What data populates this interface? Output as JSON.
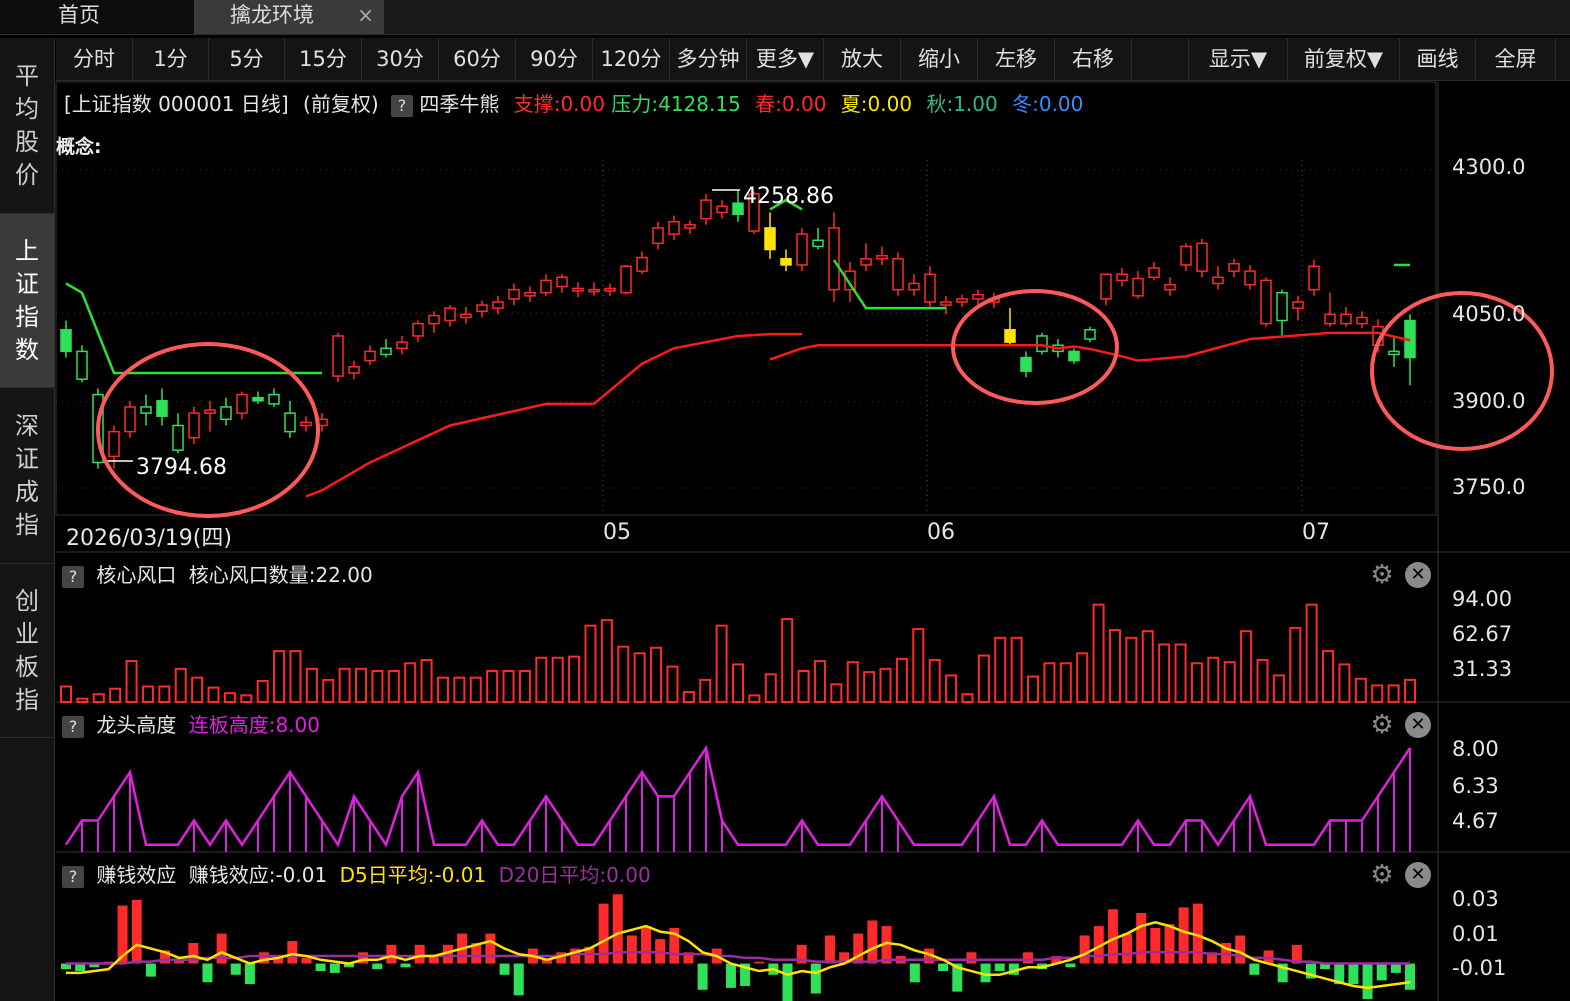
{
  "tabs": {
    "home": "首页",
    "active": "擒龙环境",
    "close": "×"
  },
  "sidebar": [
    {
      "label": "平均股价",
      "active": false
    },
    {
      "label": "上证指数",
      "active": true
    },
    {
      "label": "深证成指",
      "active": false
    },
    {
      "label": "创业板指",
      "active": false
    }
  ],
  "toolbar": [
    "分时",
    "1分",
    "5分",
    "15分",
    "30分",
    "60分",
    "90分",
    "120分",
    "多分钟",
    "更多▼",
    "放大",
    "缩小",
    "左移",
    "右移",
    "",
    "显示▼",
    "前复权▼",
    "画线",
    "全屏"
  ],
  "info": {
    "title": "[上证指数 000001 日线]",
    "adjust": "(前复权)",
    "indicator": "四季牛熊",
    "support": "支撑:0.00",
    "pressure": "压力:4128.15",
    "spring": "春:0.00",
    "summer": "夏:0.00",
    "autumn": "秋:1.00",
    "winter": "冬:0.00"
  },
  "concept_label": "概念:",
  "colors": {
    "up": "#ff2a2a",
    "down": "#2ee05a",
    "yellow": "#ffe400",
    "magenta": "#e020e0",
    "purple": "#9b2fa0",
    "green_line": "#2ee02e",
    "support_line": "#ff1a1a",
    "circle": "#ff5a5a"
  },
  "chart_data": [
    {
      "type": "candlestick",
      "title": "上证指数 000001 日线",
      "y_ticks": [
        "4300.0",
        "4050.0",
        "3900.0",
        "3750.0"
      ],
      "ylim": [
        3735,
        4310
      ],
      "x_labels": [
        "2026/03/19(四)",
        "05",
        "06",
        "07"
      ],
      "annotations": {
        "high": "4258.86",
        "low": "3794.68"
      },
      "ohlc": [
        [
          4035,
          4050,
          3990,
          4000,
          0
        ],
        [
          4000,
          4010,
          3950,
          3955,
          0
        ],
        [
          3930,
          3940,
          3810,
          3820,
          0
        ],
        [
          3830,
          3880,
          3810,
          3870,
          1
        ],
        [
          3870,
          3920,
          3860,
          3910,
          1
        ],
        [
          3910,
          3930,
          3880,
          3900,
          0
        ],
        [
          3920,
          3940,
          3880,
          3895,
          0
        ],
        [
          3880,
          3900,
          3835,
          3840,
          0
        ],
        [
          3860,
          3910,
          3850,
          3900,
          1
        ],
        [
          3900,
          3920,
          3870,
          3905,
          1
        ],
        [
          3910,
          3925,
          3880,
          3890,
          0
        ],
        [
          3900,
          3935,
          3890,
          3930,
          1
        ],
        [
          3925,
          3935,
          3915,
          3920,
          0
        ],
        [
          3930,
          3940,
          3910,
          3915,
          0
        ],
        [
          3900,
          3920,
          3860,
          3870,
          0
        ],
        [
          3885,
          3895,
          3870,
          3880,
          1
        ],
        [
          3880,
          3900,
          3870,
          3890,
          1
        ],
        [
          3960,
          4030,
          3950,
          4025,
          1
        ],
        [
          3965,
          3985,
          3955,
          3975,
          1
        ],
        [
          3985,
          4010,
          3978,
          4000,
          1
        ],
        [
          3995,
          4020,
          3990,
          4005,
          0
        ],
        [
          4005,
          4025,
          3995,
          4015,
          1
        ],
        [
          4025,
          4050,
          4015,
          4045,
          1
        ],
        [
          4045,
          4065,
          4030,
          4058,
          1
        ],
        [
          4050,
          4075,
          4040,
          4070,
          1
        ],
        [
          4055,
          4072,
          4045,
          4060,
          1
        ],
        [
          4065,
          4082,
          4055,
          4075,
          1
        ],
        [
          4070,
          4090,
          4060,
          4080,
          1
        ],
        [
          4085,
          4110,
          4075,
          4100,
          1
        ],
        [
          4090,
          4105,
          4080,
          4095,
          1
        ],
        [
          4095,
          4125,
          4090,
          4115,
          1
        ],
        [
          4105,
          4125,
          4095,
          4120,
          1
        ],
        [
          4098,
          4112,
          4088,
          4102,
          1
        ],
        [
          4098,
          4112,
          4090,
          4100,
          1
        ],
        [
          4098,
          4110,
          4090,
          4102,
          1
        ],
        [
          4095,
          4140,
          4092,
          4138,
          1
        ],
        [
          4130,
          4162,
          4125,
          4152,
          1
        ],
        [
          4175,
          4210,
          4165,
          4200,
          1
        ],
        [
          4190,
          4220,
          4180,
          4210,
          1
        ],
        [
          4200,
          4212,
          4190,
          4205,
          1
        ],
        [
          4215,
          4255,
          4205,
          4245,
          1
        ],
        [
          4225,
          4245,
          4215,
          4235,
          1
        ],
        [
          4240,
          4262,
          4210,
          4222,
          0
        ],
        [
          4195,
          4259,
          4190,
          4255,
          1
        ],
        [
          4200,
          4225,
          4150,
          4165,
          2
        ],
        [
          4150,
          4165,
          4130,
          4140,
          2
        ],
        [
          4140,
          4200,
          4130,
          4190,
          1
        ],
        [
          4180,
          4200,
          4165,
          4170,
          0
        ],
        [
          4200,
          4225,
          4080,
          4100,
          1
        ],
        [
          4100,
          4145,
          4080,
          4130,
          1
        ],
        [
          4150,
          4175,
          4130,
          4140,
          1
        ],
        [
          4155,
          4170,
          4140,
          4150,
          1
        ],
        [
          4150,
          4160,
          4090,
          4100,
          1
        ],
        [
          4110,
          4125,
          4090,
          4100,
          1
        ],
        [
          4125,
          4138,
          4070,
          4080,
          1
        ],
        [
          4075,
          4090,
          4060,
          4080,
          1
        ],
        [
          4080,
          4092,
          4072,
          4085,
          1
        ],
        [
          4085,
          4100,
          4070,
          4092,
          1
        ],
        [
          4080,
          4095,
          4070,
          4085,
          1
        ],
        [
          4035,
          4070,
          4010,
          4015,
          2
        ],
        [
          3968,
          4000,
          3958,
          3990,
          0
        ],
        [
          4000,
          4030,
          3995,
          4025,
          0
        ],
        [
          4000,
          4020,
          3990,
          4010,
          0
        ],
        [
          3985,
          4005,
          3980,
          4000,
          0
        ],
        [
          4020,
          4040,
          4015,
          4035,
          0
        ],
        [
          4085,
          4125,
          4075,
          4125,
          1
        ],
        [
          4115,
          4135,
          4105,
          4125,
          1
        ],
        [
          4090,
          4130,
          4085,
          4118,
          1
        ],
        [
          4120,
          4145,
          4115,
          4135,
          1
        ],
        [
          4100,
          4120,
          4090,
          4108,
          1
        ],
        [
          4140,
          4175,
          4130,
          4170,
          1
        ],
        [
          4130,
          4182,
          4120,
          4175,
          1
        ],
        [
          4120,
          4138,
          4100,
          4110,
          1
        ],
        [
          4130,
          4150,
          4120,
          4142,
          1
        ],
        [
          4130,
          4140,
          4100,
          4108,
          1
        ],
        [
          4045,
          4120,
          4040,
          4115,
          1
        ],
        [
          4050,
          4100,
          4025,
          4095,
          0
        ],
        [
          4080,
          4090,
          4050,
          4070,
          1
        ],
        [
          4100,
          4148,
          4090,
          4138,
          1
        ],
        [
          4060,
          4095,
          4040,
          4045,
          1
        ],
        [
          4060,
          4072,
          4040,
          4045,
          1
        ],
        [
          4055,
          4065,
          4038,
          4045,
          1
        ],
        [
          4040,
          4052,
          3998,
          4010,
          1
        ],
        [
          3995,
          4025,
          3975,
          4000,
          0
        ],
        [
          3990,
          4060,
          3945,
          4050,
          0
        ]
      ]
    },
    {
      "type": "bar",
      "title": "核心风口",
      "series_label": "核心风口数量:22.00",
      "y_ticks": [
        "94.00",
        "62.67",
        "31.33"
      ],
      "ylim": [
        0,
        94
      ],
      "values": [
        14,
        3,
        7,
        12,
        37,
        14,
        14,
        30,
        22,
        13,
        8,
        6,
        19,
        46,
        46,
        30,
        20,
        30,
        30,
        28,
        28,
        35,
        38,
        22,
        22,
        22,
        28,
        28,
        28,
        40,
        40,
        41,
        69,
        74,
        50,
        44,
        49,
        32,
        9,
        20,
        69,
        34,
        6,
        25,
        75,
        28,
        37,
        16,
        36,
        27,
        30,
        39,
        66,
        38,
        24,
        7,
        42,
        58,
        58,
        23,
        35,
        35,
        44,
        88,
        65,
        58,
        64,
        52,
        52,
        35,
        40,
        36,
        64,
        38,
        24,
        67,
        88,
        46,
        34,
        21,
        15,
        15,
        20
      ]
    },
    {
      "type": "line",
      "title": "龙头高度",
      "series_label": "连板高度:8.00",
      "y_ticks": [
        "8.00",
        "6.33",
        "4.67"
      ],
      "ylim": [
        3.7,
        8.0
      ],
      "values": [
        4,
        5,
        5,
        6,
        7,
        4,
        4,
        4,
        5,
        4,
        5,
        4,
        5,
        6,
        7,
        6,
        5,
        4,
        6,
        5,
        4,
        6,
        7,
        4,
        4,
        4,
        5,
        4,
        4,
        5,
        6,
        5,
        4,
        4,
        5,
        6,
        7,
        6,
        6,
        7,
        8,
        5,
        4,
        4,
        4,
        4,
        5,
        4,
        4,
        4,
        5,
        6,
        5,
        4,
        4,
        4,
        4,
        5,
        6,
        4,
        4,
        5,
        4,
        4,
        4,
        4,
        4,
        5,
        4,
        4,
        5,
        5,
        4,
        5,
        6,
        4,
        4,
        4,
        4,
        5,
        5,
        5,
        6,
        7,
        8
      ]
    },
    {
      "type": "bar",
      "title": "赚钱效应",
      "series": [
        {
          "name": "赚钱效应:-0.01",
          "values": [
            -0.003,
            -0.004,
            -0.002,
            0.001,
            0.031,
            0.034,
            -0.007,
            0.007,
            0.002,
            0.011,
            -0.01,
            0.016,
            -0.006,
            -0.011,
            0.006,
            0.004,
            0.012,
            0.003,
            -0.004,
            -0.005,
            -0.002,
            0.006,
            -0.003,
            0.01,
            -0.002,
            0.01,
            0.004,
            0.01,
            0.016,
            0.011,
            0.016,
            -0.006,
            -0.017,
            0.008,
            0.002,
            0.006,
            0.008,
            0.009,
            0.032,
            0.037,
            0.015,
            0.02,
            0.013,
            0.019,
            0.006,
            -0.014,
            0.008,
            -0.013,
            -0.012,
            0.001,
            -0.006,
            -0.021,
            0.01,
            -0.016,
            0.015,
            0.006,
            0.016,
            0.023,
            0.02,
            0.004,
            -0.01,
            0.008,
            -0.004,
            -0.015,
            0.006,
            -0.01,
            -0.004,
            -0.006,
            0.006,
            -0.003,
            0.004,
            -0.002,
            0.015,
            0.02,
            0.029,
            0.016,
            0.027,
            0.019,
            0.021,
            0.03,
            0.032,
            0.006,
            0.011,
            0.015,
            -0.006,
            0.007,
            -0.01,
            0.01,
            -0.008,
            -0.003,
            -0.011,
            -0.011,
            -0.019,
            -0.009,
            -0.005,
            -0.014
          ]
        },
        {
          "name": "D5日平均:-0.01",
          "values": [
            -0.005,
            -0.005,
            -0.004,
            -0.003,
            0.004,
            0.01,
            0.008,
            0.006,
            0.003,
            0.004,
            0.002,
            0.006,
            0.003,
            0,
            0.002,
            0.003,
            0.005,
            0.004,
            0.002,
            0.001,
            0,
            0.002,
            0.002,
            0.004,
            0.002,
            0.004,
            0.004,
            0.006,
            0.008,
            0.01,
            0.012,
            0.008,
            0.005,
            0.004,
            0.002,
            0.004,
            0.006,
            0.008,
            0.012,
            0.016,
            0.018,
            0.02,
            0.017,
            0.016,
            0.012,
            0.006,
            0.004,
            0,
            -0.002,
            -0.004,
            -0.003,
            -0.006,
            -0.004,
            -0.005,
            -0.002,
            0,
            0.004,
            0.008,
            0.011,
            0.01,
            0.007,
            0.005,
            0.002,
            -0.002,
            -0.004,
            -0.006,
            -0.006,
            -0.004,
            -0.002,
            -0.002,
            0,
            0.002,
            0.005,
            0.009,
            0.013,
            0.016,
            0.02,
            0.022,
            0.02,
            0.017,
            0.015,
            0.012,
            0.008,
            0.006,
            0.002,
            0,
            -0.002,
            -0.004,
            -0.006,
            -0.008,
            -0.01,
            -0.012,
            -0.013,
            -0.012,
            -0.011,
            -0.01
          ]
        },
        {
          "name": "D20日平均:0.00",
          "values": [
            0,
            0,
            0,
            0,
            0,
            0.001,
            0.001,
            0.002,
            0.002,
            0.002,
            0.003,
            0.003,
            0.003,
            0.004,
            0.004,
            0.004,
            0.004,
            0.004,
            0.004,
            0.004,
            0.004,
            0.004,
            0.004,
            0.004,
            0.004,
            0.004,
            0.004,
            0.004,
            0.004,
            0.004,
            0.004,
            0.004,
            0.004,
            0.004,
            0.004,
            0.004,
            0.005,
            0.005,
            0.005,
            0.006,
            0.006,
            0.006,
            0.006,
            0.005,
            0.005,
            0.005,
            0.004,
            0.004,
            0.003,
            0.003,
            0.002,
            0.002,
            0.002,
            0.001,
            0.001,
            0.001,
            0.001,
            0.001,
            0.002,
            0.002,
            0.002,
            0.002,
            0.002,
            0.002,
            0.002,
            0.002,
            0.002,
            0.002,
            0.002,
            0.002,
            0.003,
            0.003,
            0.004,
            0.004,
            0.005,
            0.005,
            0.006,
            0.006,
            0.006,
            0.006,
            0.006,
            0.005,
            0.005,
            0.004,
            0.003,
            0.003,
            0.002,
            0.001,
            0.001,
            0,
            0,
            0,
            0,
            0,
            0,
            0
          ]
        }
      ],
      "y_ticks": [
        "0.03",
        "0.01",
        "-0.01"
      ],
      "ylim": [
        -0.02,
        0.035
      ]
    }
  ]
}
